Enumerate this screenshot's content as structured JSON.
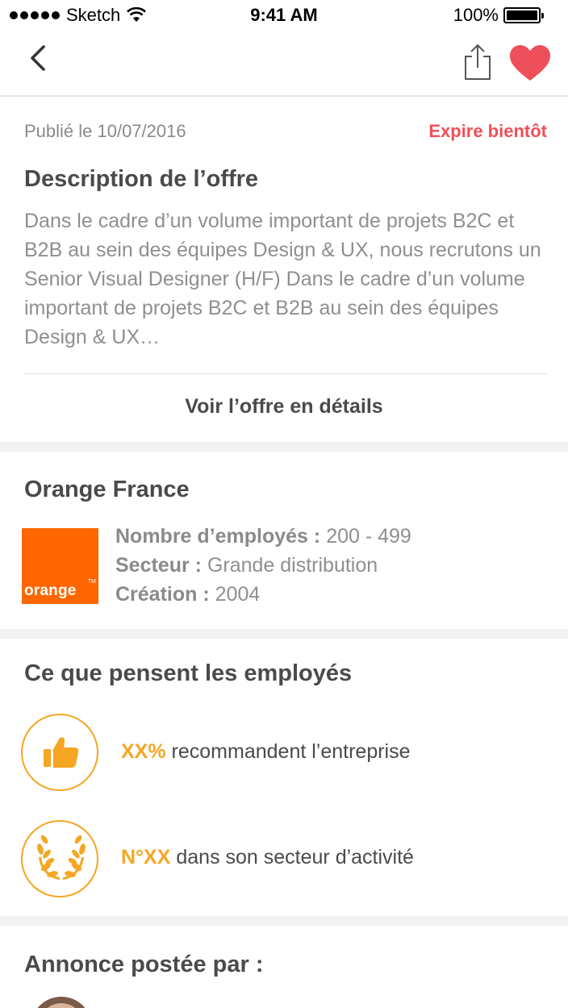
{
  "status_bar": {
    "carrier": "Sketch",
    "time": "9:41 AM",
    "battery": "100%"
  },
  "nav": {
    "back_icon": "chevron-left-icon",
    "share_icon": "share-icon",
    "favorite_icon": "heart-icon"
  },
  "offer": {
    "published": "Publié le 10/07/2016",
    "expire": "Expire bientôt",
    "title": "Description de l’offre",
    "description": "Dans le cadre d’un volume important de projets B2C et B2B au sein des équipes Design & UX, nous recrutons un Senior Visual Designer (H/F) Dans le cadre d’un volume important de projets B2C et B2B au sein des équipes Design & UX…",
    "details_link": "Voir l’offre en détails"
  },
  "company": {
    "name": "Orange France",
    "logo_text": "orange",
    "logo_tm": "TM",
    "employees_label": "Nombre d’employés :",
    "employees_value": "200 - 499",
    "sector_label": "Secteur :",
    "sector_value": "Grande distribution",
    "creation_label": "Création :",
    "creation_value": "2004"
  },
  "employees_opinion": {
    "title": "Ce que pensent les employés",
    "recommend_highlight": "XX%",
    "recommend_text": "recommandent l’entreprise",
    "rank_highlight": "N°XX",
    "rank_text": "dans son secteur d’activité"
  },
  "posted_by": {
    "title": "Annonce postée par :"
  },
  "colors": {
    "accent_red": "#ef4f5a",
    "accent_orange": "#f5a623",
    "brand_orange": "#ff6600",
    "separator": "#f2f2f2"
  }
}
